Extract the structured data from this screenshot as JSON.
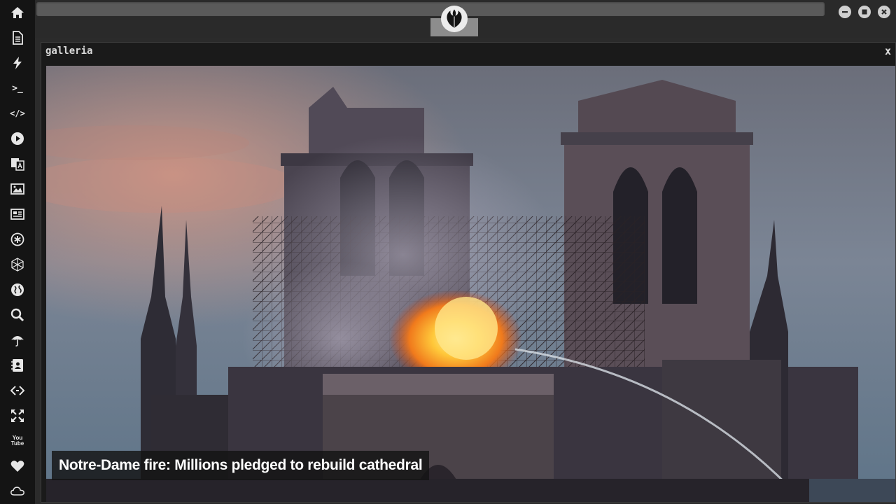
{
  "sidebar": {
    "items": [
      {
        "name": "home-icon"
      },
      {
        "name": "document-icon"
      },
      {
        "name": "lightning-icon"
      },
      {
        "name": "terminal-icon",
        "label": ">_"
      },
      {
        "name": "code-icon",
        "label": "</>"
      },
      {
        "name": "play-icon"
      },
      {
        "name": "translate-icon"
      },
      {
        "name": "image-icon"
      },
      {
        "name": "news-icon"
      },
      {
        "name": "asterisk-icon"
      },
      {
        "name": "hexagon-icon"
      },
      {
        "name": "globe-icon"
      },
      {
        "name": "search-icon"
      },
      {
        "name": "umbrella-icon"
      },
      {
        "name": "contacts-icon"
      },
      {
        "name": "code-fork-icon"
      },
      {
        "name": "expand-icon"
      },
      {
        "name": "youtube-icon",
        "label": "You Tube"
      },
      {
        "name": "heart-icon"
      },
      {
        "name": "cloud-icon"
      }
    ]
  },
  "topbar": {
    "emblem": "rebel-alliance-icon",
    "controls": [
      "minimize-icon",
      "maximize-icon",
      "close-icon"
    ]
  },
  "gallery": {
    "title": "galleria",
    "close_label": "x",
    "caption": "Notre-Dame fire: Millions pledged to rebuild cathedral"
  },
  "colors": {
    "sidebar_bg": "#141414",
    "window_bg": "#2b2b2b",
    "url_bar": "#5a5a5a",
    "caption_bg": "#141414"
  }
}
